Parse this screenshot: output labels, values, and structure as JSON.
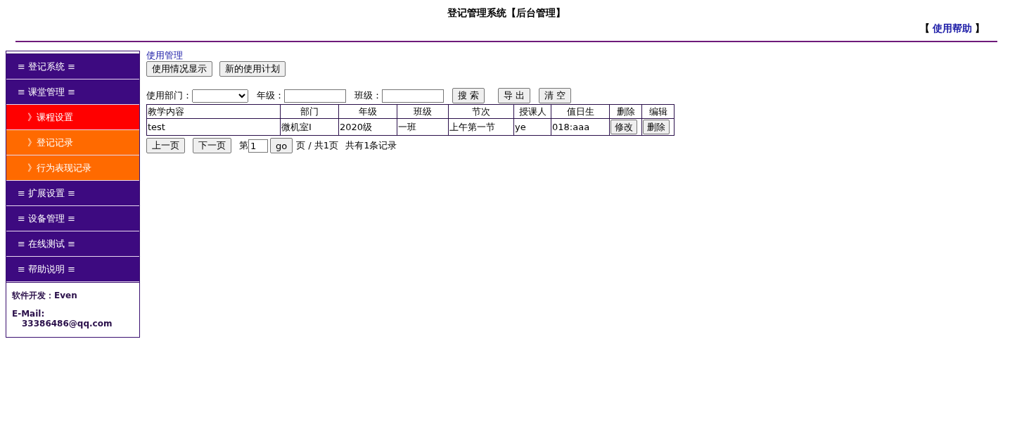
{
  "header": {
    "title": "登记管理系统【后台管理】",
    "help": {
      "open_bracket": "【",
      "link": "使用帮助",
      "close_bracket": "】"
    }
  },
  "sidebar": {
    "items": [
      {
        "kind": "section",
        "label": "≡ 登记系统 ≡",
        "selected": false
      },
      {
        "kind": "section",
        "label": "≡ 课堂管理 ≡",
        "selected": false
      },
      {
        "kind": "item",
        "label": "》课程设置",
        "selected": true
      },
      {
        "kind": "item",
        "label": "》登记记录",
        "selected": false
      },
      {
        "kind": "item",
        "label": "》行为表现记录",
        "selected": false
      },
      {
        "kind": "section",
        "label": "≡ 扩展设置 ≡",
        "selected": false
      },
      {
        "kind": "section",
        "label": "≡ 设备管理 ≡",
        "selected": false
      },
      {
        "kind": "section",
        "label": "≡ 在线测试 ≡",
        "selected": false
      },
      {
        "kind": "section",
        "label": "≡ 帮助说明 ≡",
        "selected": false
      }
    ],
    "footer": {
      "developer": "软件开发：Even",
      "email_label": "E-Mail:",
      "email": "33386486@qq.com"
    }
  },
  "main": {
    "breadcrumb": "使用管理",
    "actions": [
      "使用情况显示",
      "新的使用计划"
    ],
    "filters": {
      "department_label": "使用部门：",
      "grade_label": "年级：",
      "class_label": "班级：",
      "buttons": [
        "搜 索",
        "导 出",
        "清 空"
      ]
    },
    "table": {
      "columns": [
        "教学内容",
        "部门",
        "年级",
        "班级",
        "节次",
        "授课人",
        "值日生",
        "删除",
        "编辑"
      ],
      "rows": [
        {
          "cells": [
            "test",
            "微机室I",
            "2020级",
            "一班",
            "上午第一节",
            "ye",
            "018:aaa"
          ],
          "buttons": [
            "修改",
            "删除"
          ]
        }
      ]
    },
    "pager": {
      "prev": "上一页",
      "next": "下一页",
      "page_prefix": "第",
      "page_value": "1",
      "go": "go",
      "page_suffix": "页 / 共1页",
      "total": "共有1条记录"
    }
  }
}
